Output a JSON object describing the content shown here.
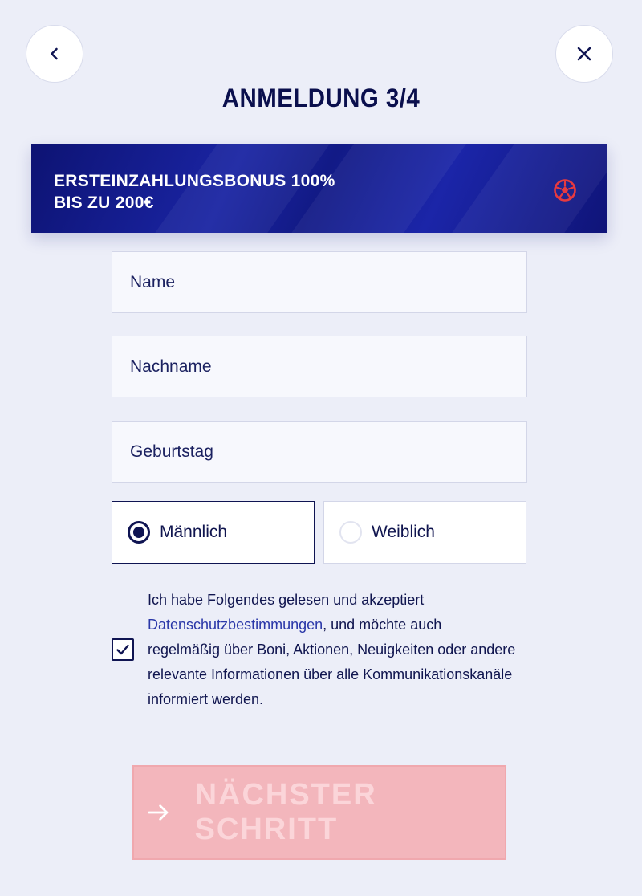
{
  "header": {
    "title": "ANMELDUNG 3/4",
    "back_icon": "chevron-left-icon",
    "close_icon": "close-icon"
  },
  "banner": {
    "line1": "ERSTEINZAHLUNGSBONUS 100%",
    "line2": "BIS ZU 200€",
    "icon": "football-icon",
    "icon_color": "#e83a3f",
    "background": "#141c8f"
  },
  "form": {
    "name_placeholder": "Name",
    "surname_placeholder": "Nachname",
    "birthday_placeholder": "Geburtstag",
    "gender_options": [
      {
        "label": "Männlich",
        "selected": true
      },
      {
        "label": "Weiblich",
        "selected": false
      }
    ],
    "consent": {
      "checked": true,
      "text_before": "Ich habe Folgendes gelesen und akzeptiert ",
      "link": "Datenschutzbestimmungen",
      "text_after": ", und möchte auch regelmäßig über Boni, Aktionen, Neuigkeiten oder andere relevante Informationen über alle Kommunikationskanäle informiert werden."
    }
  },
  "next_button": {
    "label": "NÄCHSTER SCHRITT",
    "icon": "arrow-right-icon",
    "color": "#f3b6bc"
  }
}
